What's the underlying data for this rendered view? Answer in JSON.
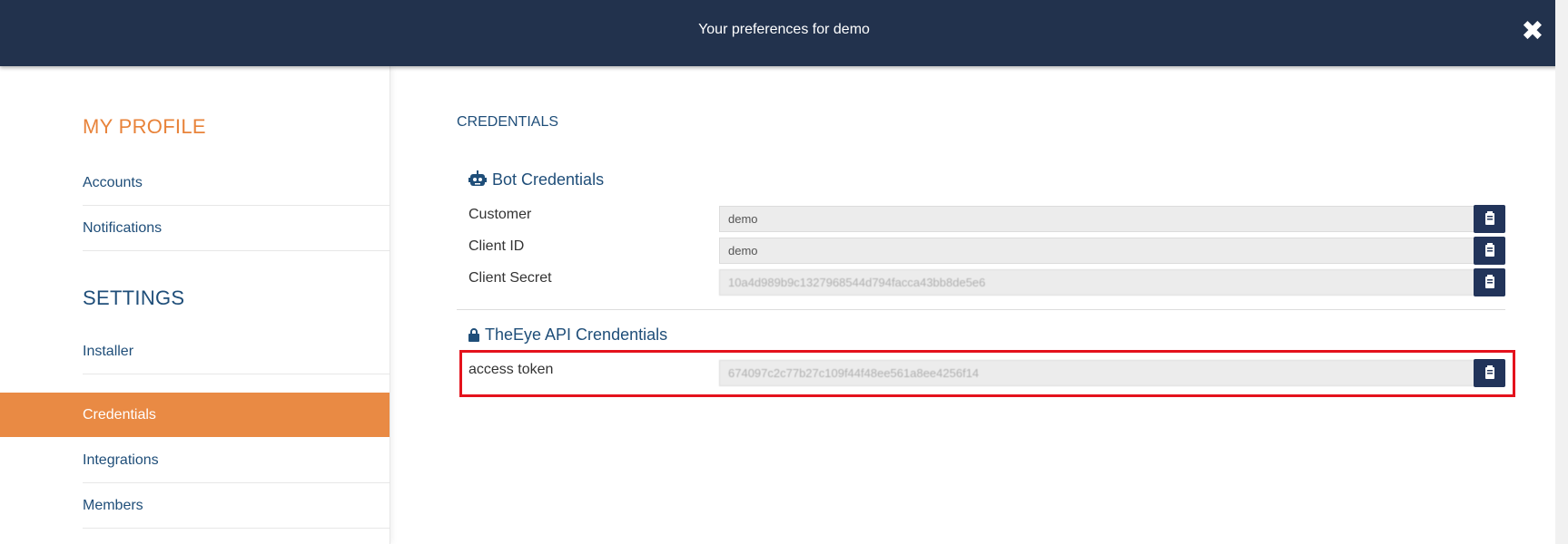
{
  "header": {
    "title": "Your preferences for demo",
    "close_icon": "close-icon"
  },
  "sidebar": {
    "profile_heading": "MY PROFILE",
    "profile_items": [
      {
        "label": "Accounts"
      },
      {
        "label": "Notifications"
      }
    ],
    "settings_heading": "SETTINGS",
    "settings_items": [
      {
        "label": "Installer"
      },
      {
        "label": "Credentials",
        "active": true
      },
      {
        "label": "Integrations"
      },
      {
        "label": "Members"
      }
    ],
    "active_color": "#e98a44"
  },
  "main": {
    "title": "CREDENTIALS",
    "bot": {
      "icon": "robot-icon",
      "title": "Bot Credentials",
      "rows": [
        {
          "label": "Customer",
          "value": "demo"
        },
        {
          "label": "Client ID",
          "value": "demo"
        },
        {
          "label": "Client Secret",
          "value": "10a4d989b9c1327968544d794facca43bb8de5e6"
        }
      ]
    },
    "api": {
      "icon": "lock-icon",
      "title": "TheEye API Crendentials",
      "rows": [
        {
          "label": "access token",
          "value": "674097c2c77b27c109f44f48ee561a8ee4256f14"
        }
      ]
    },
    "copy_icon": "clipboard-icon",
    "highlight_color": "#e4121c"
  }
}
